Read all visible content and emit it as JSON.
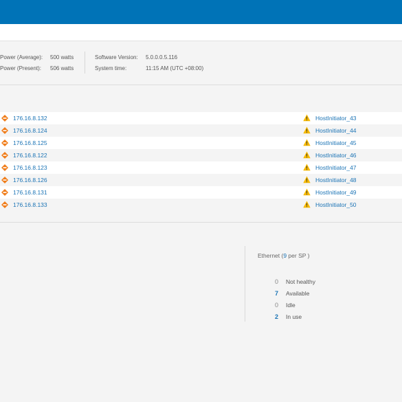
{
  "header": {},
  "system_info": {
    "power_average_label": "Power (Average):",
    "power_average_value": "500 watts",
    "power_present_label": "Power (Present):",
    "power_present_value": "506 watts",
    "software_version_label": "Software Version:",
    "software_version_value": "5.0.0.0.5.116",
    "system_time_label": "System time:",
    "system_time_value": "11:15 AM (UTC +08:00)"
  },
  "rows": [
    {
      "ip": "176.16.8.132",
      "host": "HostInitiator_43"
    },
    {
      "ip": "176.16.8.124",
      "host": "HostInitiator_44"
    },
    {
      "ip": "176.16.8.125",
      "host": "HostInitiator_45"
    },
    {
      "ip": "176.16.8.122",
      "host": "HostInitiator_46"
    },
    {
      "ip": "176.16.8.123",
      "host": "HostInitiator_47"
    },
    {
      "ip": "176.16.8.126",
      "host": "HostInitiator_48"
    },
    {
      "ip": "176.16.8.131",
      "host": "HostInitiator_49"
    },
    {
      "ip": "176.16.8.133",
      "host": "HostInitiator_50"
    }
  ],
  "ethernet": {
    "title_prefix": "Ethernet (",
    "per_sp_count": "9",
    "title_suffix": " per SP )",
    "stats": [
      {
        "value": "0",
        "label": "Not healthy",
        "emphasis": false
      },
      {
        "value": "7",
        "label": "Available",
        "emphasis": true
      },
      {
        "value": "0",
        "label": "Idle",
        "emphasis": false
      },
      {
        "value": "2",
        "label": "In use",
        "emphasis": true
      }
    ]
  },
  "colors": {
    "topbar": "#0073b7",
    "link": "#1a73b5",
    "ip_status_icon": "#f07d1a",
    "warning_icon": "#f5b800"
  },
  "icons": {
    "ip_status": "orange-diamond-status-icon",
    "host": "warning-triangle-icon"
  }
}
